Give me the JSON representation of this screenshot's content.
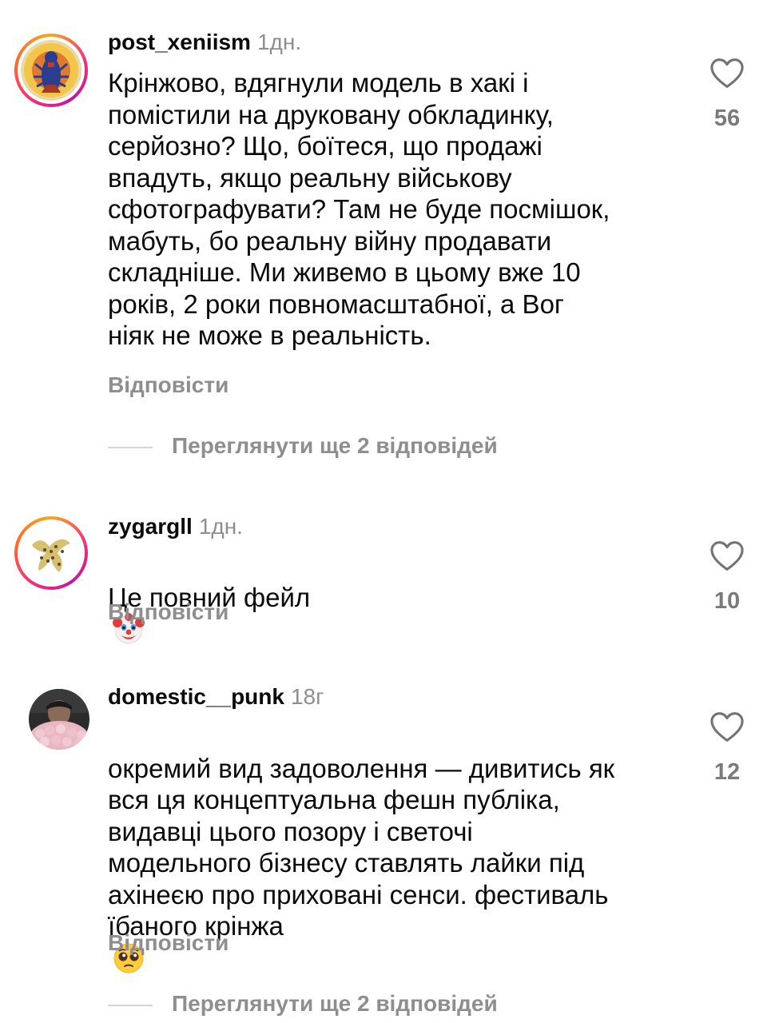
{
  "comments": [
    {
      "username": "post_xeniism",
      "time": "1дн.",
      "text": "Крінжово, вдягнули модель в хакі і\nпомістили на друковану обкладинку,\nсерйозно? Що, боїтеся, що продажі\nвпадуть, якщо реальну військову\nсфотографувати? Там не буде посмішок,\nмабуть, бо реальну війну продавати\nскладніше. Ми живемо в цьому вже 10\nроків, 2 роки повномасштабної, а Вог\nніяк не може в реальність.",
      "reply_label": "Відповісти",
      "likes": "56",
      "view_replies": "Переглянути ще 2 відповідей"
    },
    {
      "username": "zygargll",
      "time": "1дн.",
      "text": "Це повний фейл",
      "emoji": "clown-face",
      "reply_label": "Відповісти",
      "likes": "10"
    },
    {
      "username": "domestic__punk",
      "time": "18г",
      "text": "окремий вид задоволення — дивитись як\nвся ця концептуальна фешн публіка,\nвидавці цього позору і светочі\nмодельного бізнесу ставлять лайки під\nахінеєю про приховані сенси. фестиваль\nїбаного крінжа",
      "emoji": "pleading-face",
      "reply_label": "Відповісти",
      "likes": "12",
      "view_replies": "Переглянути ще 2 відповідей"
    }
  ]
}
